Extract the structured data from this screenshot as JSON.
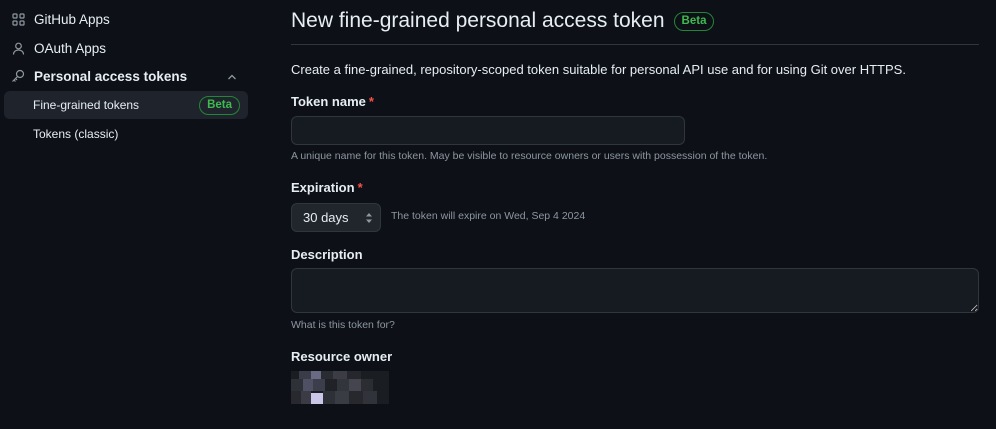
{
  "sidebar": {
    "items": [
      {
        "label": "GitHub Apps",
        "icon": "apps-grid-icon"
      },
      {
        "label": "OAuth Apps",
        "icon": "person-icon"
      },
      {
        "label": "Personal access tokens",
        "icon": "key-icon",
        "expanded": true
      }
    ],
    "subitems": [
      {
        "label": "Fine-grained tokens",
        "badge": "Beta",
        "active": true
      },
      {
        "label": "Tokens (classic)"
      }
    ]
  },
  "main": {
    "title": "New fine-grained personal access token",
    "title_badge": "Beta",
    "intro": "Create a fine-grained, repository-scoped token suitable for personal API use and for using Git over HTTPS.",
    "token_name": {
      "label": "Token name",
      "required_mark": "*",
      "value": "",
      "placeholder": "",
      "note": "A unique name for this token. May be visible to resource owners or users with possession of the token."
    },
    "expiration": {
      "label": "Expiration",
      "required_mark": "*",
      "selected": "30 days",
      "note": "The token will expire on Wed, Sep 4 2024"
    },
    "description": {
      "label": "Description",
      "value": "",
      "note": "What is this token for?"
    },
    "resource_owner": {
      "label": "Resource owner"
    }
  },
  "colors": {
    "background": "#0d1117",
    "text": "#e6edf3",
    "muted": "#8d96a0",
    "border": "#30363d",
    "beta_green": "#3fb950",
    "required_red": "#f85149"
  }
}
